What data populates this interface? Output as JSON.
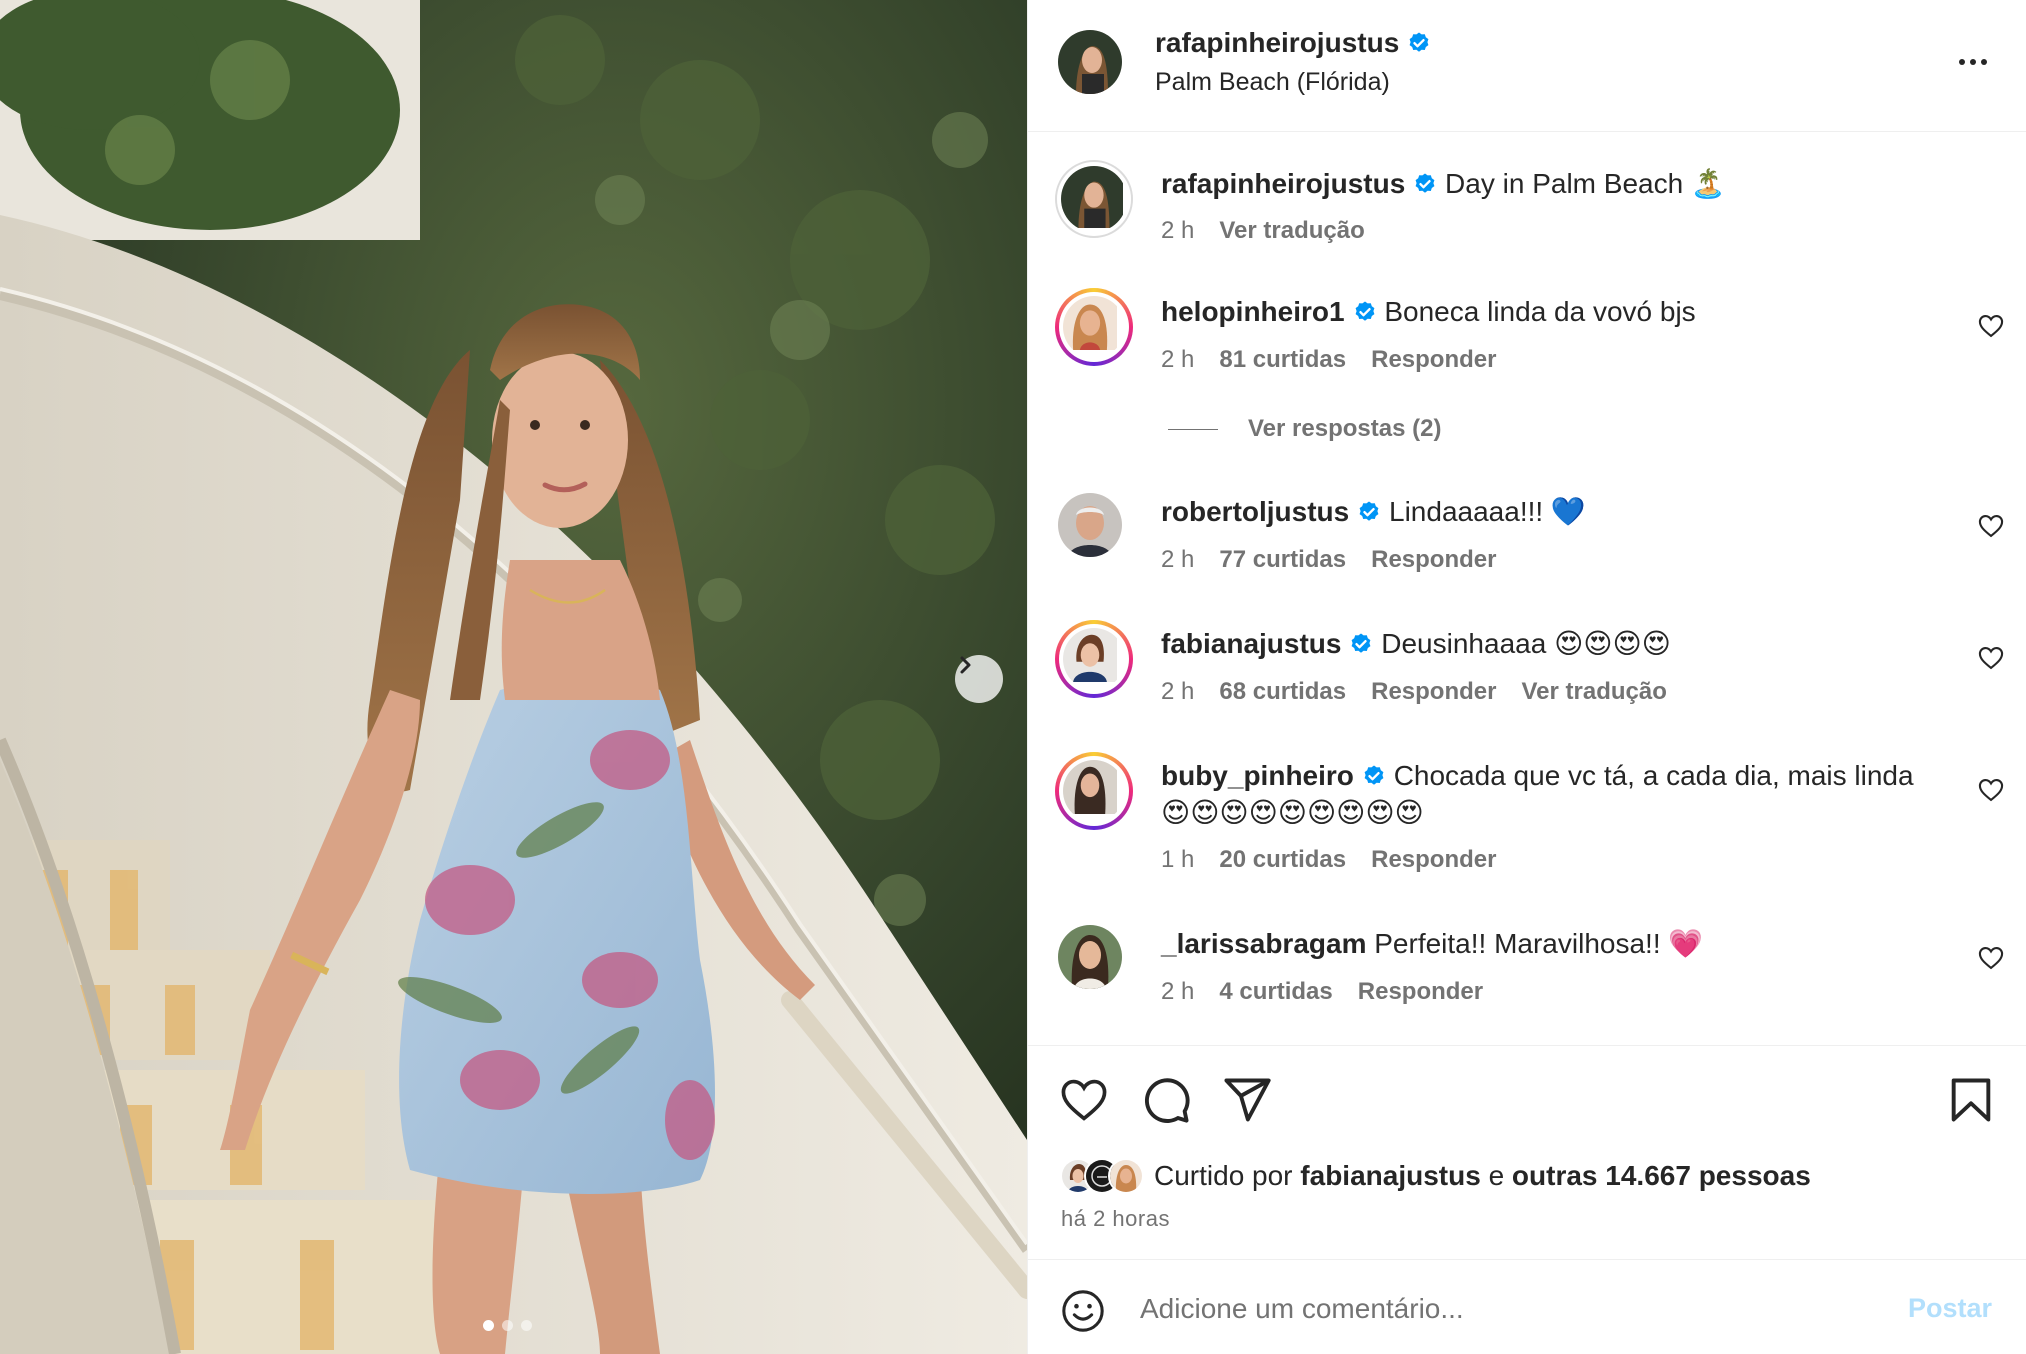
{
  "post": {
    "username": "rafapinheirojustus",
    "location": "Palm Beach (Flórida)"
  },
  "caption": {
    "username": "rafapinheirojustus",
    "text": "Day in Palm Beach 🏝️",
    "time": "2 h",
    "translate": "Ver tradução"
  },
  "comments": [
    {
      "username": "helopinheiro1",
      "text": "Boneca linda da vovó bjs",
      "time": "2 h",
      "likes": "81 curtidas",
      "reply": "Responder"
    },
    {
      "username": "robertoljustus",
      "text": "Lindaaaaa!!! 💙",
      "time": "2 h",
      "likes": "77 curtidas",
      "reply": "Responder"
    },
    {
      "username": "fabianajustus",
      "text": "Deusinhaaaa 😍😍😍😍",
      "time": "2 h",
      "likes": "68 curtidas",
      "reply": "Responder",
      "translate": "Ver tradução"
    },
    {
      "username": "buby_pinheiro",
      "text": "Chocada que vc tá, a cada dia, mais linda",
      "text2": "😍😍😍😍😍😍😍😍😍",
      "time": "1 h",
      "likes": "20 curtidas",
      "reply": "Responder"
    },
    {
      "username": "_larissabragam",
      "text": "Perfeita!! Maravilhosa!! 💗",
      "time": "2 h",
      "likes": "4 curtidas",
      "reply": "Responder"
    }
  ],
  "view_replies": "Ver respostas (2)",
  "likes_summary": {
    "prefix": "Curtido por",
    "user": "fabianajustus",
    "conj": "e",
    "others": "outras 14.667 pessoas"
  },
  "posted_ago": "há 2 horas",
  "add_comment": {
    "placeholder": "Adicione um comentário...",
    "post_label": "Postar"
  },
  "carousel": {
    "slides": 3,
    "current": 1
  },
  "colors": {
    "verified": "#0095f6",
    "muted": "#737373",
    "text": "#262626",
    "post_disabled": "#b2dffc"
  }
}
